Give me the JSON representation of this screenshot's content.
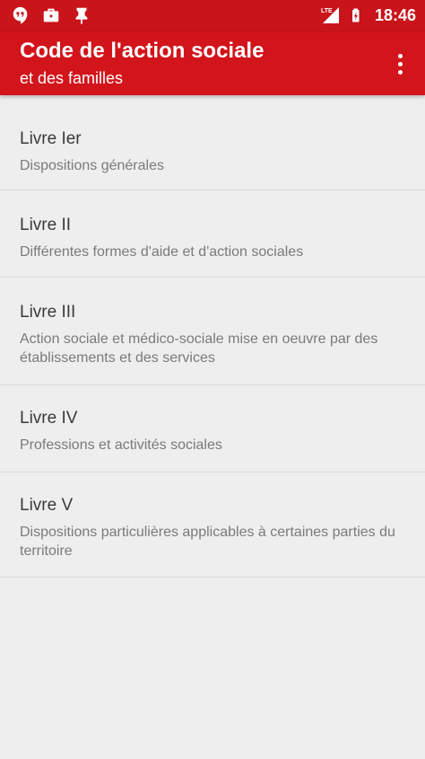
{
  "status_bar": {
    "left_icons": [
      "hangouts-icon",
      "briefcase-icon",
      "pin-icon"
    ],
    "right_icons": [
      "cell-signal-icon",
      "battery-icon"
    ],
    "network_label": "LTE",
    "time": "18:46"
  },
  "app_bar": {
    "title": "Code de l'action sociale",
    "subtitle": "et des familles",
    "menu_icon": "more-vert-icon"
  },
  "books": [
    {
      "title": "Livre Ier",
      "description": "Dispositions générales"
    },
    {
      "title": "Livre II",
      "description": "Différentes formes d'aide et d'action sociales"
    },
    {
      "title": "Livre III",
      "description": "Action sociale et médico-sociale mise en oeuvre par des établissements et des services"
    },
    {
      "title": "Livre IV",
      "description": "Professions et activités sociales"
    },
    {
      "title": "Livre V",
      "description": "Dispositions particulières applicables à certaines parties du territoire"
    }
  ],
  "colors": {
    "status_bar": "#c8141a",
    "app_bar": "#d2141b",
    "background": "#eeeeee",
    "divider": "#d9d9d9",
    "title_text": "#3a3a3a",
    "secondary_text": "#7a7a7a"
  }
}
